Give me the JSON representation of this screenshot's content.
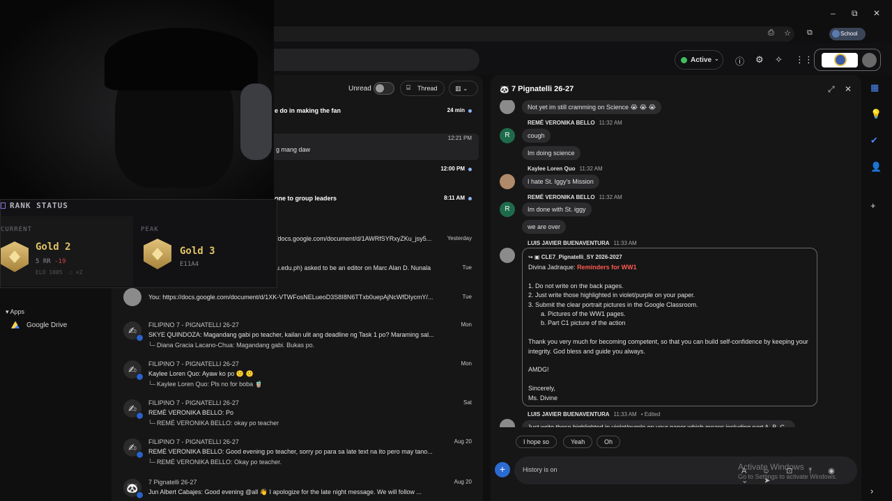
{
  "window": {
    "minimize": "–",
    "restore": "⧉",
    "close": "✕"
  },
  "browser": {
    "profile_label": "School"
  },
  "header": {
    "status_label": "Active",
    "status_color": "#3fbf5d",
    "icons": [
      "help-icon",
      "settings-icon",
      "gemini-icon",
      "apps-grid-icon"
    ]
  },
  "webcam": {
    "rank_status": {
      "title": "RANK STATUS",
      "current_label": "CURRENT",
      "current_rank": "Gold 2",
      "rr": "5 RR",
      "rr_change": "-19",
      "elo": "ELO 1005",
      "streak": "×2",
      "peak_label": "PEAK",
      "peak_rank": "Gold 3",
      "peak_episode": "E11A4"
    }
  },
  "sidebar": {
    "apps_label": "Apps",
    "apps": [
      {
        "label": "Google Drive"
      }
    ]
  },
  "list": {
    "filter_unread": "Unread",
    "filter_thread": "Thread",
    "rows": [
      {
        "line1": "",
        "line2": "e do in making the fan",
        "line3": "",
        "time": "24 min",
        "unread": true
      },
      {
        "line1": "",
        "line2": "g mang daw",
        "line3": "",
        "time": "12:21 PM",
        "unread": false
      },
      {
        "line1": "",
        "line2": "",
        "line3": "",
        "time": "12:00 PM",
        "unread": true
      },
      {
        "line1": "",
        "line2": "one to group leaders",
        "line3": "",
        "time": "8:11 AM",
        "unread": true
      },
      {
        "line1": "",
        "line2": "/docs.google.com/document/d/1AWRfSYRxyZKu_jsy5...",
        "line3": "",
        "time": "Yesterday",
        "unread": false
      },
      {
        "line1": "",
        "line2": "u.edu.ph) asked to be an editor on Marc Alan D. Nunala",
        "line3": "",
        "time": "Tue",
        "unread": false
      },
      {
        "line1": "",
        "line2": "You: https://docs.google.com/document/d/1XK-VTWFosNELueoD3S8I8N6TTxb0uepAjNcWfDIycmY/...",
        "line3": "",
        "time": "Tue",
        "unread": false
      },
      {
        "line1": "FILIPINO 7 - PIGNATELLI 26-27",
        "line2": "SKYE QUINDOZA: Magandang gabi po teacher, kailan ulit ang deadline ng Task 1 po? Maraming sal...",
        "line3": "Diana Gracia Lacano-Chua: Magandang gabi. Bukas po.",
        "time": "Mon",
        "unread": false
      },
      {
        "line1": "FILIPINO 7 - PIGNATELLI 26-27",
        "line2": "Kaylee Loren Quo: Ayaw ko po 🙁 🙁",
        "line3": "Kaylee Loren Quo: Pls no for boba 🧋",
        "time": "Mon",
        "unread": false
      },
      {
        "line1": "FILIPINO 7 - PIGNATELLI 26-27",
        "line2": "REMÉ VERONIKA BELLO: Po",
        "line3": "REMÉ VERONIKA BELLO: okay po teacher",
        "time": "Sat",
        "unread": false
      },
      {
        "line1": "FILIPINO 7 - PIGNATELLI 26-27",
        "line2": "REMÉ VERONIKA BELLO: Good evening po teacher, sorry po para sa late text na ito pero may tano...",
        "line3": "REMÉ VERONIKA BELLO: Okay po teacher.",
        "time": "Aug 20",
        "unread": false
      },
      {
        "line1": "7 Pignatelli 26-27",
        "line2": "Jun Albert Cabajes: Good evening @all 👋 I apologize for the late night message. We will follow ...",
        "line3": "",
        "time": "Aug 20",
        "unread": false
      }
    ]
  },
  "chat": {
    "title": "7 Pignatelli 26-27",
    "messages": {
      "m0": "Not yet im still cramming on Science 😭 😭 😭",
      "s1_name": "REMÉ VERONIKA BELLO",
      "s1_time": "11:32 AM",
      "m1a": "cough",
      "m1b": "Im doing science",
      "s2_name": "Kaylee Loren Quo",
      "s2_time": "11:32 AM",
      "m2": "I hate St. Iggy's Mission",
      "s3_name": "REMÉ VERONIKA BELLO",
      "s3_time": "11:32 AM",
      "m3a": "Im done with St. iggy",
      "m3b": "we are over",
      "s4_name": "LUIS JAVIER BUENAVENTURA",
      "s4_time": "11:33 AM",
      "fwd_source": "CLE7_Pignatelli_SY 2026-2027",
      "fwd_author": "Divina Jadraque:",
      "fwd_heading": "Reminders for WW1",
      "fwd_lines": [
        "1. Do not write on the back pages.",
        "2.  Just write those highlighted in violet/purple on your paper.",
        "3. Submit the clear portrait pictures in the Google Classroom."
      ],
      "fwd_sub": [
        "a. Pictures of the WW1 pages.",
        "b. Part C1 picture of the action"
      ],
      "fwd_thanks": "Thank you very much for becoming competent, so that you can build self-confidence by keeping your integrity.  God bless and guide you always.",
      "fwd_amdg": "AMDG!",
      "fwd_sincerely": "Sincerely,",
      "fwd_sign": "Ms. Divine",
      "s5_name": "LUIS JAVIER BUENAVENTURA",
      "s5_time": "11:33 AM",
      "s5_edited": "• Edited",
      "m5": "Just write those highlighted in violet/purple on your paper which means including part A, B, C..."
    },
    "smart_replies": [
      "I hope so",
      "Yeah",
      "Oh"
    ],
    "composer_placeholder": "History is on",
    "watermark_title": "Activate Windows",
    "watermark_sub": "Go to Settings to activate Windows."
  }
}
